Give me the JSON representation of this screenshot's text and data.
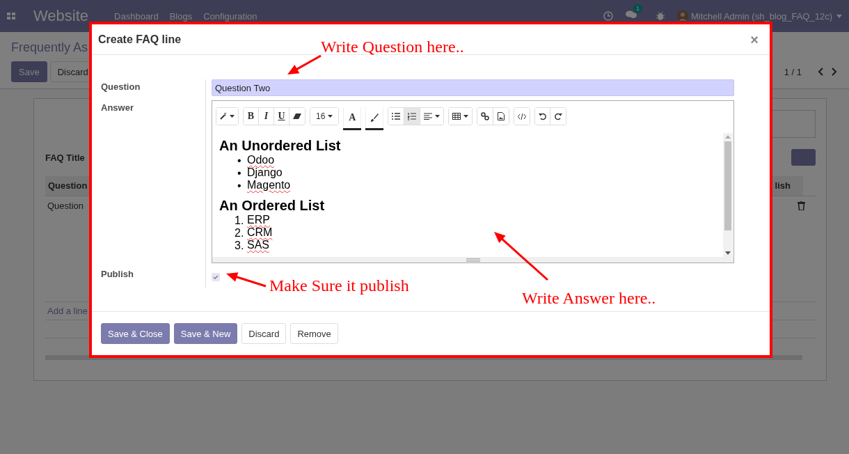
{
  "navbar": {
    "app_name": "Website",
    "menu": [
      "Dashboard",
      "Blogs",
      "Configuration"
    ],
    "chat_badge": "1",
    "user": "Mitchell Admin (sh_blog_FAQ_12c)"
  },
  "control_panel": {
    "breadcrumb": "Frequently As",
    "buttons": [
      {
        "label": "Save",
        "kind": "primary"
      },
      {
        "label": "Discard",
        "kind": "secondary"
      }
    ],
    "pager": "1 / 1"
  },
  "sheet": {
    "field_label": "FAQ Title",
    "table": {
      "columns": [
        "Question",
        "lish"
      ],
      "rows": [
        [
          "Question"
        ]
      ],
      "add_line": "Add a line"
    }
  },
  "dialog": {
    "title": "Create FAQ line",
    "close": "×",
    "question": {
      "label": "Question",
      "value": "Question Two"
    },
    "answer": {
      "label": "Answer",
      "toolbar": [
        [
          {
            "kind": "style",
            "selected": false
          }
        ],
        [
          {
            "kind": "bold",
            "text": "B",
            "selected": false
          },
          {
            "kind": "italic",
            "text": "I",
            "selected": false
          },
          {
            "kind": "underline",
            "text": "U",
            "selected": false
          },
          {
            "kind": "eraser",
            "selected": false
          }
        ],
        [
          {
            "kind": "fontsize",
            "text": "16",
            "selected": false
          }
        ],
        [
          {
            "kind": "forecolor",
            "text": "A",
            "selected": false
          }
        ],
        [
          {
            "kind": "backcolor",
            "selected": false
          }
        ],
        [
          {
            "kind": "ul",
            "selected": false
          },
          {
            "kind": "ol",
            "selected": true
          },
          {
            "kind": "align",
            "selected": false
          }
        ],
        [
          {
            "kind": "table",
            "selected": false
          }
        ],
        [
          {
            "kind": "link",
            "selected": false
          },
          {
            "kind": "image",
            "selected": false
          }
        ],
        [
          {
            "kind": "code",
            "selected": false
          }
        ],
        [
          {
            "kind": "undo",
            "selected": false
          },
          {
            "kind": "redo",
            "selected": false
          }
        ]
      ],
      "content": [
        {
          "kind": "heading",
          "text": "An Unordered List"
        },
        {
          "kind": "bullets",
          "items": [
            {
              "marker": "•",
              "text": "Odoo",
              "misspelled": true
            },
            {
              "marker": "•",
              "text": "Django",
              "misspelled": false
            },
            {
              "marker": "•",
              "text": "Magento",
              "misspelled": true
            }
          ]
        },
        {
          "kind": "heading",
          "text": "An Ordered List"
        },
        {
          "kind": "numbers",
          "items": [
            {
              "marker": "1.",
              "text": "ERP",
              "misspelled": true
            },
            {
              "marker": "2.",
              "text": "CRM",
              "misspelled": true
            },
            {
              "marker": "3.",
              "text": "SAS",
              "misspelled": true
            }
          ]
        }
      ]
    },
    "publish": {
      "label": "Publish",
      "checked": true
    },
    "buttons": [
      {
        "label": "Save & Close",
        "kind": "primary"
      },
      {
        "label": "Save & New",
        "kind": "primary"
      },
      {
        "label": "Discard",
        "kind": "secondary"
      },
      {
        "label": "Remove",
        "kind": "secondary"
      }
    ]
  },
  "annotations": [
    {
      "text": "Write Question here.."
    },
    {
      "text": "Write Answer here.."
    },
    {
      "text": "Make Sure it publish"
    }
  ]
}
